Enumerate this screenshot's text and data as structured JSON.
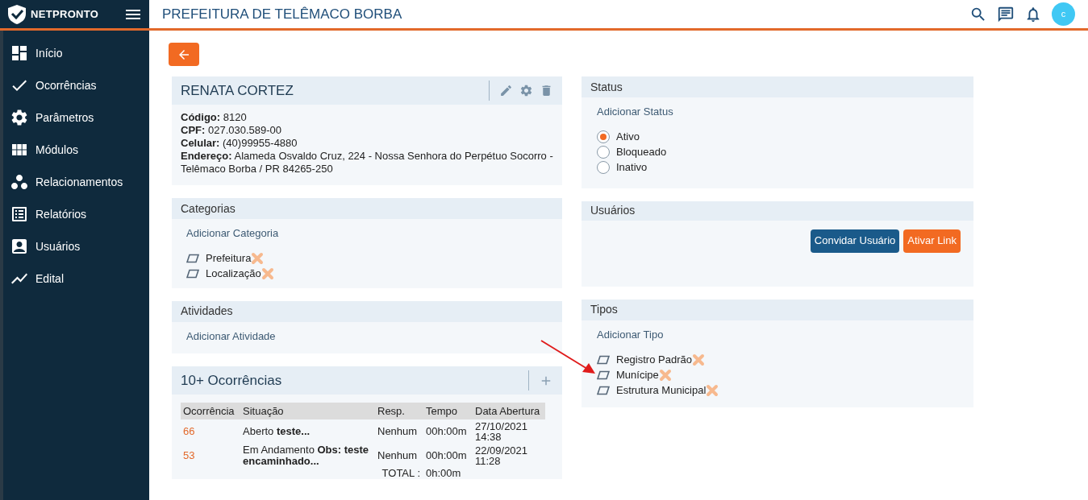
{
  "header": {
    "logo_text": "NETPRONTO",
    "title": "PREFEITURA DE TELÊMACO BORBA",
    "avatar": "c"
  },
  "sidebar": {
    "items": [
      {
        "label": "Início",
        "kind": "dashboard"
      },
      {
        "label": "Ocorrências",
        "kind": "check"
      },
      {
        "label": "Parâmetros",
        "kind": "gear"
      },
      {
        "label": "Módulos",
        "kind": "grid"
      },
      {
        "label": "Relacionamentos",
        "kind": "dots"
      },
      {
        "label": "Relatórios",
        "kind": "list"
      },
      {
        "label": "Usuários",
        "kind": "user"
      },
      {
        "label": "Edital",
        "kind": "chart"
      }
    ]
  },
  "person": {
    "name": "RENATA CORTEZ",
    "fields": [
      {
        "label": "Código:",
        "value": "8120"
      },
      {
        "label": "CPF:",
        "value": "027.030.589-00"
      },
      {
        "label": "Celular:",
        "value": "(40)99955-4880"
      },
      {
        "label": "Endereço:",
        "value": "Alameda Osvaldo Cruz, 224 - Nossa Senhora do Perpétuo Socorro - Telêmaco Borba / PR 84265-250"
      }
    ]
  },
  "categorias": {
    "title": "Categorias",
    "add_link": "Adicionar Categoria",
    "items": [
      "Prefeitura",
      "Localização"
    ]
  },
  "atividades": {
    "title": "Atividades",
    "add_link": "Adicionar Atividade"
  },
  "ocorrencias": {
    "title": "10+ Ocorrências",
    "columns": [
      "Ocorrência",
      "Situação",
      "Resp.",
      "Tempo",
      "Data Abertura"
    ],
    "rows": [
      {
        "id": "66",
        "situacao": "Aberto **teste...**",
        "resp": "Nenhum",
        "tempo": "00h:00m",
        "data": "27/10/2021 14:38"
      },
      {
        "id": "53",
        "situacao": "Em Andamento **Obs: teste encaminhado...**",
        "resp": "Nenhum",
        "tempo": "00h:00m",
        "data": "22/09/2021 11:28"
      }
    ],
    "total_label": "TOTAL :",
    "total_value": "0h:00m"
  },
  "status": {
    "title": "Status",
    "add_link": "Adicionar Status",
    "options": [
      {
        "label": "Ativo",
        "selected": true
      },
      {
        "label": "Bloqueado",
        "selected": false
      },
      {
        "label": "Inativo",
        "selected": false
      }
    ]
  },
  "usuarios": {
    "title": "Usuários",
    "buttons": [
      {
        "label": "Convidar Usuário",
        "kind": "primary"
      },
      {
        "label": "Ativar Link",
        "kind": "accent"
      }
    ]
  },
  "tipos": {
    "title": "Tipos",
    "add_link": "Adicionar Tipo",
    "items": [
      "Registro Padrão",
      "Munícipe",
      "Estrutura Municipal"
    ]
  }
}
